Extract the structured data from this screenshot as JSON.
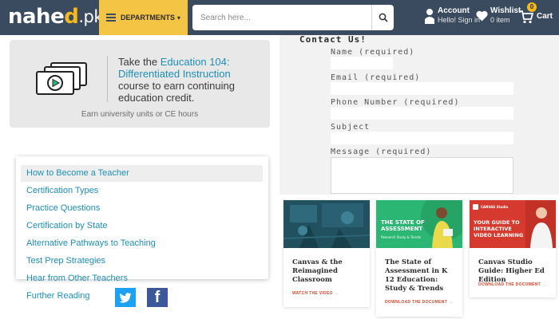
{
  "header": {
    "logo": {
      "part1": "nahe",
      "part2": "d",
      "suffix": ".pk"
    },
    "departments_label": "DEPARTMENTS",
    "search_placeholder": "Search here...",
    "account": {
      "title": "Account",
      "subtitle": "Hello! Sign in"
    },
    "wishlist": {
      "title": "Wishlist",
      "subtitle": "0 item"
    },
    "cart": {
      "title": "Cart",
      "count": "0"
    },
    "colors": {
      "bar": "#3a4a5f",
      "accent": "#f4c544"
    }
  },
  "promo": {
    "text_before": "Take the ",
    "link": "Education 104: Differentiated Instruction",
    "text_after": " course to earn continuing education credit.",
    "footer": "Earn university units or CE hours"
  },
  "menu": {
    "items": [
      "How to Become a Teacher",
      "Certification Types",
      "Practice Questions",
      "Certification by State",
      "Alternative Pathways to Teaching",
      "Test Prep Strategies",
      "Hear from Other Teachers",
      "Further Reading"
    ]
  },
  "contact": {
    "title": "Contact Us!",
    "fields": {
      "name": "Name (required)",
      "email": "Email (required)",
      "phone": "Phone Number (required)",
      "subject": "Subject",
      "message": "Message (required)"
    }
  },
  "cards": [
    {
      "title": "Canvas & the Reimagined Classroom",
      "cta": "WATCH THE VIDEO →"
    },
    {
      "banner": "THE STATE OF ASSESSMENT",
      "banner_sub": "Research Study & Trends",
      "title": "The State of Assessment in K 12 Education: Study & Trends",
      "cta": "DOWNLOAD THE DOCUMENT →"
    },
    {
      "brand": "CANVAS Studio",
      "banner": "YOUR GUIDE TO INTERACTIVE VIDEO LEARNING",
      "title": "Canvas Studio Guide: Higher Ed Edition",
      "cta": "DOWNLOAD THE DOCUMENT →"
    }
  ]
}
